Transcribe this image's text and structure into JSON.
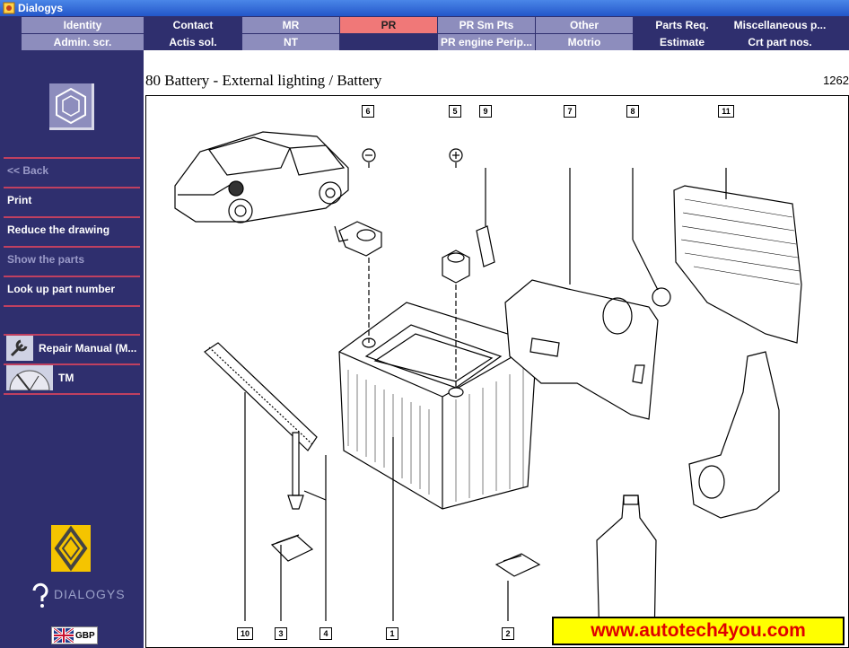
{
  "window": {
    "title": "Dialogys"
  },
  "tabs_row1": [
    {
      "label": "Identity",
      "style": "light"
    },
    {
      "label": "Contact",
      "style": "dark"
    },
    {
      "label": "MR",
      "style": "light"
    },
    {
      "label": "PR",
      "style": "active"
    },
    {
      "label": "PR Sm Pts",
      "style": "light"
    },
    {
      "label": "Other",
      "style": "light"
    },
    {
      "label": "Parts Req.",
      "style": "dark"
    },
    {
      "label": "Miscellaneous p...",
      "style": "dark"
    }
  ],
  "tabs_row2": [
    {
      "label": "Admin. scr.",
      "style": "light"
    },
    {
      "label": "Actis sol.",
      "style": "dark"
    },
    {
      "label": "NT",
      "style": "light"
    },
    {
      "label": "",
      "style": "dark"
    },
    {
      "label": "PR engine Perip...",
      "style": "light"
    },
    {
      "label": "Motrio",
      "style": "light"
    },
    {
      "label": "Estimate",
      "style": "dark"
    },
    {
      "label": "Crt part nos.",
      "style": "dark"
    }
  ],
  "sidebar": {
    "items": [
      {
        "label": "<< Back",
        "enabled": false
      },
      {
        "label": "Print",
        "enabled": true
      },
      {
        "label": "Reduce the drawing",
        "enabled": true
      },
      {
        "label": "Show the parts",
        "enabled": false
      },
      {
        "label": "Look up part number",
        "enabled": true
      }
    ],
    "tools": [
      {
        "label": "Repair Manual (M...",
        "icon": "wrench-icon"
      },
      {
        "label": "TM",
        "icon": "clock-icon"
      }
    ],
    "brand": "DIALOGYS",
    "currency": "GBP"
  },
  "drawing": {
    "title": "80 Battery - External lighting / Battery",
    "code": "1262",
    "callouts": [
      "6",
      "5",
      "9",
      "7",
      "8",
      "11",
      "10",
      "3",
      "4",
      "1",
      "2"
    ],
    "polarity": {
      "negative": "−",
      "positive": "+"
    },
    "watermark": "www.autotech4you.com"
  },
  "colors": {
    "window_bg": "#2f2f6e",
    "tab_light": "#8d8dbd",
    "tab_active": "#f07878",
    "separator": "#c04060",
    "banner_bg": "#ffff00",
    "banner_text": "#e00000"
  }
}
